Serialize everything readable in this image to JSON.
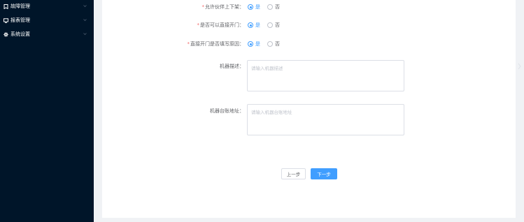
{
  "sidebar": {
    "items": [
      {
        "label": "故障管理",
        "icon": "bookmark-icon"
      },
      {
        "label": "报表管理",
        "icon": "monitor-icon"
      },
      {
        "label": "系统设置",
        "icon": "gear-icon"
      }
    ]
  },
  "form": {
    "partner_shelf": {
      "label": "允许伙伴上下架",
      "options": [
        "是",
        "否"
      ],
      "selected": "是"
    },
    "direct_open": {
      "label": "是否可以直接开门",
      "options": [
        "是",
        "否"
      ],
      "selected": "是"
    },
    "reason_required": {
      "label": "直接开门是否填写原因",
      "options": [
        "是",
        "否"
      ],
      "selected": "是"
    },
    "machine_desc": {
      "label": "机器描述",
      "value": "",
      "placeholder": "请输入机器描述"
    },
    "machine_address": {
      "label": "机器台账地址",
      "value": "",
      "placeholder": "请输入机器台账地址"
    },
    "label_suffix": "：",
    "required_mark": "*"
  },
  "buttons": {
    "prev": "上一步",
    "next": "下一步"
  },
  "colors": {
    "sidebar_bg": "#001529",
    "primary": "#409eff",
    "required": "#f56c6c"
  }
}
